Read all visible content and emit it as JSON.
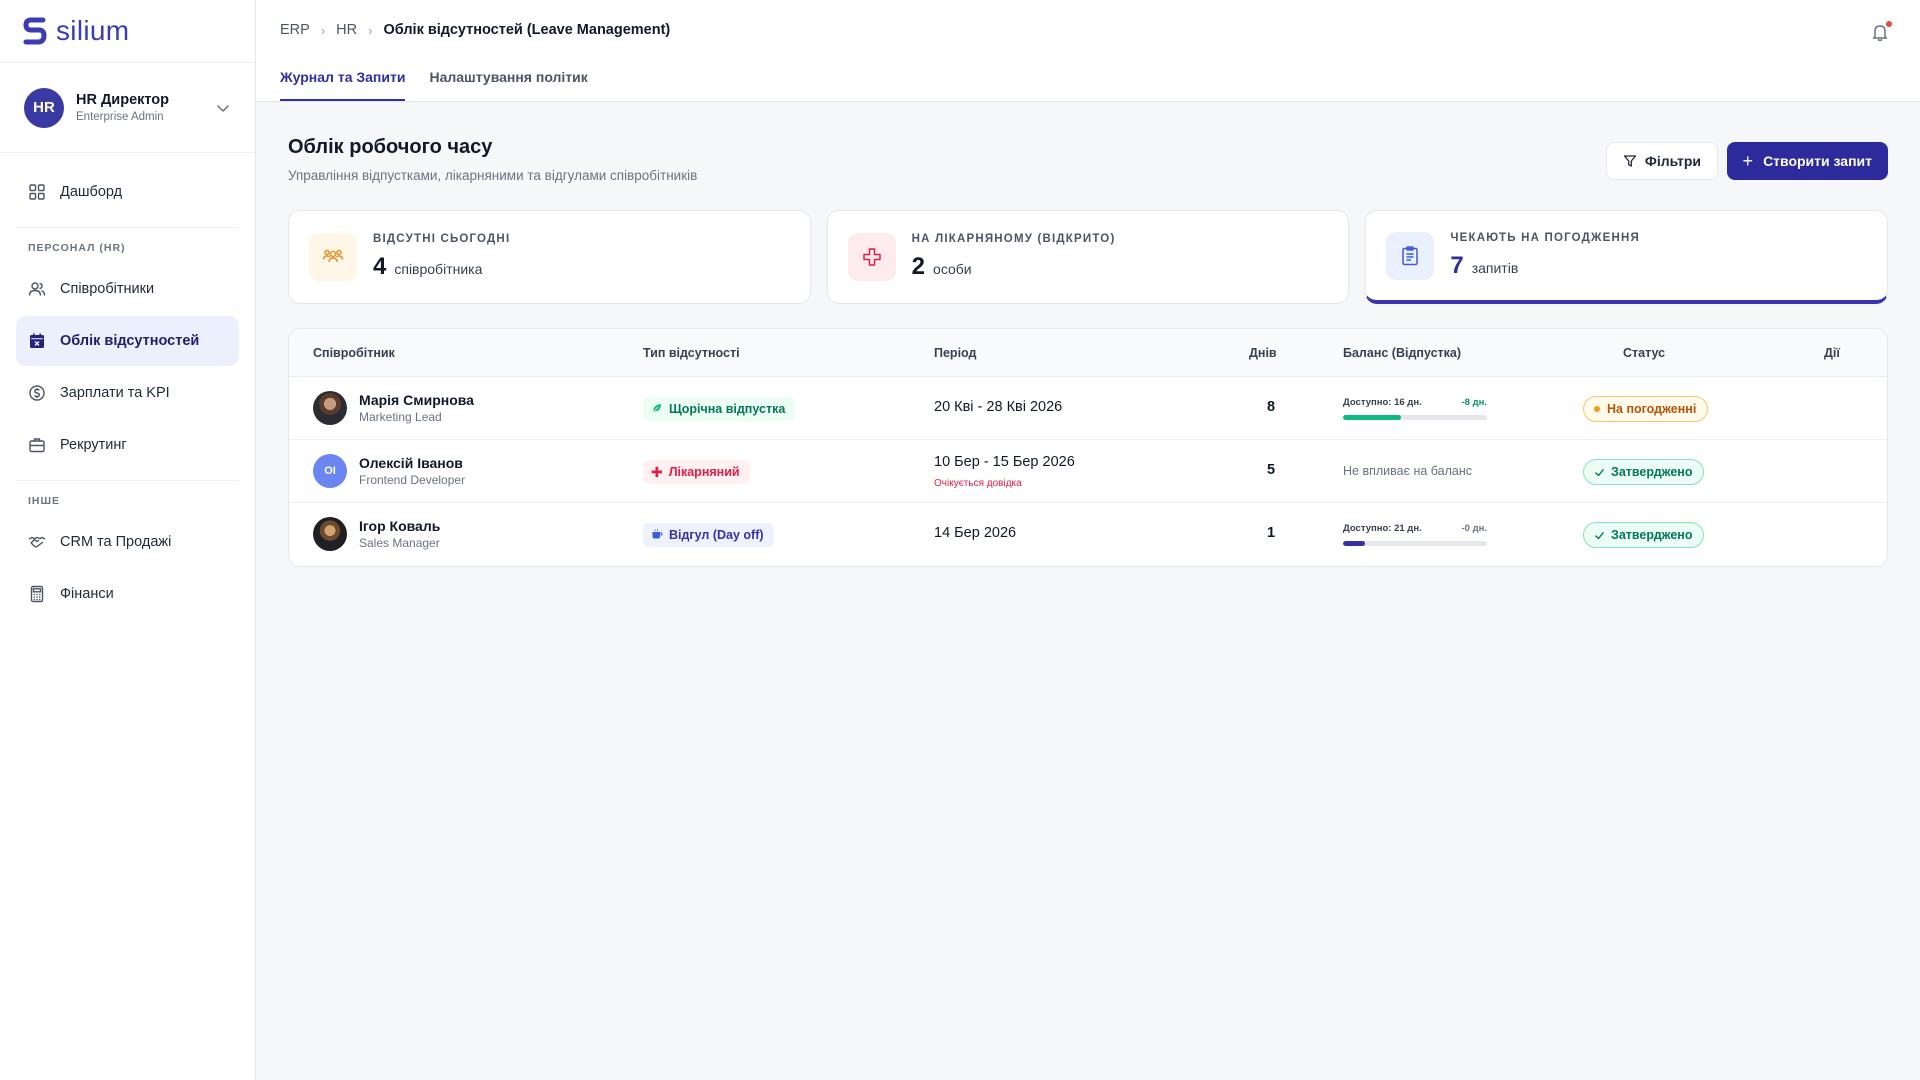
{
  "brand": {
    "name": "silium"
  },
  "profile": {
    "initials": "HR",
    "name": "HR Директор",
    "role": "Enterprise Admin"
  },
  "nav": {
    "dashboard": "Дашборд",
    "section_hr": "ПЕРСОНАЛ (HR)",
    "employees": "Співробітники",
    "absences": "Облік відсутностей",
    "payroll": "Зарплати та KPI",
    "recruiting": "Рекрутинг",
    "section_other": "ІНШЕ",
    "crm": "CRM та Продажі",
    "finance": "Фінанси"
  },
  "breadcrumb": {
    "root": "ERP",
    "section": "HR",
    "current": "Облік відсутностей (Leave Management)"
  },
  "tabs": {
    "journal": "Журнал та Запити",
    "policies": "Налаштування політик"
  },
  "page": {
    "title": "Облік робочого часу",
    "subtitle": "Управління відпустками, лікарняними та відгулами співробітників",
    "filter_label": "Фільтри",
    "create_label": "Створити запит"
  },
  "stats": [
    {
      "label": "ВІДСУТНІ СЬОГОДНІ",
      "value": "4",
      "unit": "співробітника",
      "icon": "users-icon"
    },
    {
      "label": "НА ЛІКАРНЯНОМУ (ВІДКРИТО)",
      "value": "2",
      "unit": "особи",
      "icon": "medical-cross-icon"
    },
    {
      "label": "ЧЕКАЮТЬ НА ПОГОДЖЕННЯ",
      "value": "7",
      "unit": "запитів",
      "icon": "clipboard-icon"
    }
  ],
  "table": {
    "headers": {
      "employee": "Співробітник",
      "type": "Тип відсутності",
      "period": "Період",
      "days": "Днів",
      "balance": "Баланс (Відпустка)",
      "status": "Статус",
      "actions": "Дії"
    },
    "rows": [
      {
        "name": "Марія Смирнова",
        "position": "Marketing Lead",
        "type": "Щорічна відпустка",
        "period": "20 Кві - 28 Кві 2026",
        "period_note": "",
        "days": "8",
        "balance_label": "Доступно: 16 дн.",
        "balance_delta": "-8 дн.",
        "balance_fraction": 0.4,
        "status": "На погодженні"
      },
      {
        "name": "Олексій Іванов",
        "position": "Frontend Developer",
        "initials": "OI",
        "type": "Лікарняний",
        "period": "10 Бер - 15 Бер 2026",
        "period_note": "Очікується довідка",
        "days": "5",
        "balance_note": "Не впливає на баланс",
        "status": "Затверджено"
      },
      {
        "name": "Ігор Коваль",
        "position": "Sales Manager",
        "type": "Відгул (Day off)",
        "period": "14 Бер 2026",
        "period_note": "",
        "days": "1",
        "balance_label": "Доступно: 21 дн.",
        "balance_delta": "-0 дн.",
        "balance_fraction": 0.15,
        "status": "Затверджено"
      }
    ]
  },
  "colors": {
    "brand": "#2d2a9b",
    "approved": "#047857",
    "pending": "#b45309",
    "sick": "#e11d48",
    "progress_green": "#10b981",
    "progress_indigo": "#3730a3"
  }
}
